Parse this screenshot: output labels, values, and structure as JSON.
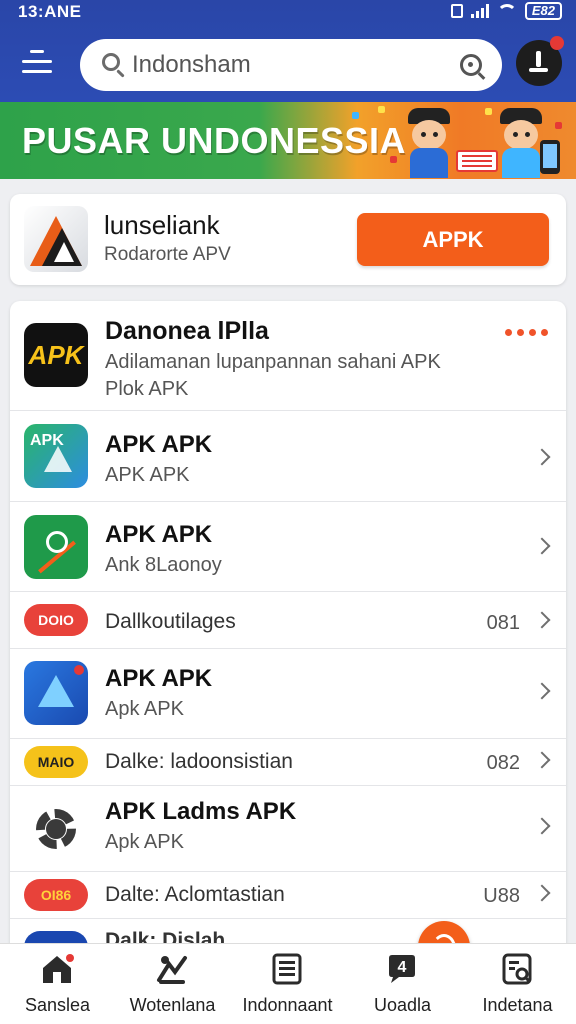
{
  "status_bar": {
    "time": "13:ANE",
    "battery": "E82",
    "icons": [
      "vibrate-icon",
      "signal-icon",
      "wifi-icon",
      "battery-icon"
    ]
  },
  "header": {
    "search_value": "Indonsham",
    "menu_icon": "menu-icon",
    "search_icon": "search-icon",
    "lens_icon": "lens-icon",
    "profile_icon": "profile-icon"
  },
  "banner": {
    "title": "PUSAR UNDONESSIA"
  },
  "featured": {
    "title": "lunseliank",
    "subtitle": "Rodarorte APV",
    "button": "APPK"
  },
  "list": {
    "header_item": {
      "title": "Danonea lPlla",
      "line1": "Adilamanan lupanpannan sahani APK",
      "line2": "Plok APK",
      "icon_text": "APK"
    },
    "items": [
      {
        "title": "APK APK",
        "subtitle": "APK APK",
        "icon_text": "APK"
      },
      {
        "title": "APK APK",
        "subtitle": "Ank 8Laonoy"
      },
      {
        "text": "Dallkoutilages",
        "number": "081",
        "icon_text": "DOIO"
      },
      {
        "title": "APK APK",
        "subtitle": "Apk APK"
      },
      {
        "text": "Dalke: ladoonsistian",
        "number": "082",
        "icon_text": "MAIO"
      },
      {
        "title": "APK Ladms APK",
        "subtitle": "Apk APK"
      },
      {
        "text": "Dalte: Aclomtastian",
        "number": "U88",
        "icon_text": "OI86"
      },
      {
        "text": "Dalk: Dislah"
      }
    ]
  },
  "bottom_nav": [
    {
      "label": "Sanslea",
      "icon": "home-icon"
    },
    {
      "label": "Wotenlana",
      "icon": "explore-icon"
    },
    {
      "label": "Indonnaant",
      "icon": "news-icon"
    },
    {
      "label": "Uoadla",
      "icon": "chat-icon"
    },
    {
      "label": "Indetana",
      "icon": "profile-card-icon"
    }
  ],
  "colors": {
    "header": "#2a46a8",
    "accent": "#f35e1a",
    "banner_green": "#2ea24a",
    "banner_orange": "#f07a26"
  }
}
